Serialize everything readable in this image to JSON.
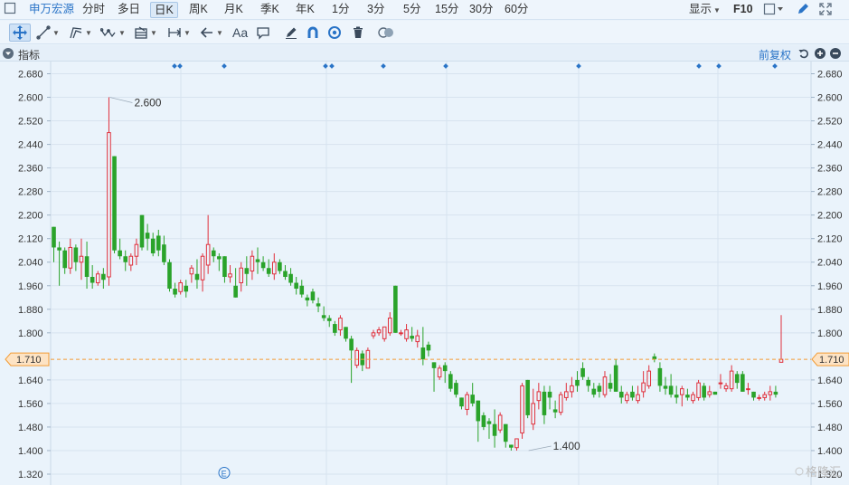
{
  "topbar": {
    "stock_name": "申万宏源",
    "periods": [
      "分时",
      "多日",
      "日K",
      "周K",
      "月K",
      "季K",
      "年K",
      "1分",
      "3分",
      "5分",
      "15分",
      "30分",
      "60分"
    ],
    "active_period": "日K",
    "display_label": "显示",
    "f10_label": "F10"
  },
  "toolbar": {
    "text_tool_label": "Aa"
  },
  "indicator_bar": {
    "label": "指标",
    "adjust_label": "前复权"
  },
  "icons": [
    "arrows-cross-icon",
    "line-tool-icon",
    "polyline-tool-icon",
    "wave-tool-icon",
    "fib-tool-icon",
    "measure-tool-icon",
    "arrow-left-icon",
    "text-tool-icon",
    "comment-icon",
    "pen-icon",
    "magnet-icon",
    "eye-icon",
    "trash-icon",
    "toggle-icon",
    "square-icon",
    "pencil-icon",
    "fullscreen-icon",
    "undo-icon",
    "zoom-in-icon",
    "zoom-out-icon",
    "chevron-down-icon"
  ],
  "colors": {
    "up": "#e0303c",
    "down": "#2aa32a",
    "accent": "#2a74c7",
    "current_line": "#f39b33"
  },
  "watermark": "格隆汇",
  "event_marker": "E",
  "chart_data": {
    "type": "candlestick",
    "y_ticks": [
      "2.680",
      "2.600",
      "2.520",
      "2.440",
      "2.360",
      "2.280",
      "2.200",
      "2.120",
      "2.040",
      "1.960",
      "1.880",
      "1.800",
      "1.640",
      "1.560",
      "1.480",
      "1.400",
      "1.320"
    ],
    "ylim": [
      1.32,
      2.68
    ],
    "current_price": "1.710",
    "annotations": [
      {
        "text": "2.600",
        "value": 2.6,
        "index": 10
      },
      {
        "text": "1.400",
        "value": 1.4,
        "index": 86
      }
    ],
    "candles": [
      [
        2.16,
        2.16,
        2.04,
        2.09
      ],
      [
        2.09,
        2.11,
        1.96,
        2.08
      ],
      [
        2.08,
        2.09,
        2.0,
        2.02
      ],
      [
        2.02,
        2.12,
        2.0,
        2.09
      ],
      [
        2.09,
        2.1,
        2.01,
        2.04
      ],
      [
        2.04,
        2.12,
        1.98,
        2.06
      ],
      [
        2.06,
        2.11,
        1.95,
        1.99
      ],
      [
        1.99,
        2.03,
        1.95,
        1.97
      ],
      [
        1.97,
        2.01,
        1.96,
        2.0
      ],
      [
        2.0,
        2.02,
        1.95,
        1.98
      ],
      [
        1.99,
        2.6,
        1.96,
        2.48
      ],
      [
        2.4,
        2.4,
        2.07,
        2.08
      ],
      [
        2.08,
        2.12,
        2.05,
        2.06
      ],
      [
        2.06,
        2.08,
        2.01,
        2.04
      ],
      [
        2.03,
        2.07,
        2.01,
        2.06
      ],
      [
        2.06,
        2.12,
        2.03,
        2.1
      ],
      [
        2.2,
        2.2,
        2.08,
        2.09
      ],
      [
        2.14,
        2.17,
        2.08,
        2.12
      ],
      [
        2.12,
        2.14,
        2.06,
        2.07
      ],
      [
        2.13,
        2.15,
        2.06,
        2.08
      ],
      [
        2.1,
        2.13,
        2.03,
        2.04
      ],
      [
        2.04,
        2.05,
        1.94,
        1.95
      ],
      [
        1.95,
        1.97,
        1.92,
        1.93
      ],
      [
        1.94,
        1.98,
        1.93,
        1.97
      ],
      [
        1.96,
        1.98,
        1.92,
        1.94
      ],
      [
        2.0,
        2.03,
        1.97,
        2.02
      ],
      [
        2.0,
        2.05,
        1.95,
        1.98
      ],
      [
        1.98,
        2.07,
        1.94,
        2.06
      ],
      [
        2.03,
        2.2,
        2.0,
        2.1
      ],
      [
        2.08,
        2.09,
        2.04,
        2.06
      ],
      [
        2.06,
        2.07,
        2.01,
        2.05
      ],
      [
        2.06,
        2.06,
        1.97,
        1.99
      ],
      [
        1.99,
        2.03,
        1.97,
        2.0
      ],
      [
        1.96,
        2.02,
        1.92,
        1.92
      ],
      [
        1.97,
        2.04,
        1.94,
        2.02
      ],
      [
        2.02,
        2.06,
        1.96,
        2.0
      ],
      [
        2.01,
        2.08,
        1.98,
        2.06
      ],
      [
        2.05,
        2.09,
        2.0,
        2.04
      ],
      [
        2.04,
        2.06,
        2.01,
        2.02
      ],
      [
        2.02,
        2.05,
        1.99,
        2.0
      ],
      [
        2.0,
        2.07,
        1.98,
        2.04
      ],
      [
        2.04,
        2.05,
        2.0,
        2.01
      ],
      [
        2.01,
        2.03,
        1.98,
        1.99
      ],
      [
        2.0,
        2.02,
        1.96,
        1.97
      ],
      [
        1.97,
        1.99,
        1.93,
        1.95
      ],
      [
        1.96,
        1.98,
        1.92,
        1.93
      ],
      [
        1.92,
        1.93,
        1.89,
        1.91
      ],
      [
        1.94,
        1.95,
        1.9,
        1.91
      ],
      [
        1.9,
        1.92,
        1.87,
        1.89
      ],
      [
        1.86,
        1.89,
        1.84,
        1.85
      ],
      [
        1.85,
        1.86,
        1.82,
        1.84
      ],
      [
        1.83,
        1.84,
        1.79,
        1.8
      ],
      [
        1.81,
        1.86,
        1.79,
        1.85
      ],
      [
        1.82,
        1.82,
        1.77,
        1.78
      ],
      [
        1.78,
        1.79,
        1.63,
        1.74
      ],
      [
        1.69,
        1.75,
        1.68,
        1.74
      ],
      [
        1.73,
        1.74,
        1.67,
        1.69
      ],
      [
        1.68,
        1.75,
        1.68,
        1.74
      ],
      [
        1.79,
        1.81,
        1.78,
        1.8
      ],
      [
        1.8,
        1.82,
        1.79,
        1.81
      ],
      [
        1.78,
        1.82,
        1.77,
        1.82
      ],
      [
        1.8,
        1.87,
        1.79,
        1.85
      ],
      [
        1.96,
        1.96,
        1.8,
        1.8
      ],
      [
        1.8,
        1.81,
        1.79,
        1.8
      ],
      [
        1.78,
        1.83,
        1.77,
        1.81
      ],
      [
        1.79,
        1.82,
        1.77,
        1.78
      ],
      [
        1.77,
        1.81,
        1.75,
        1.79
      ],
      [
        1.75,
        1.82,
        1.69,
        1.71
      ],
      [
        1.76,
        1.77,
        1.72,
        1.74
      ],
      [
        1.7,
        1.7,
        1.6,
        1.68
      ],
      [
        1.65,
        1.69,
        1.64,
        1.68
      ],
      [
        1.69,
        1.7,
        1.63,
        1.67
      ],
      [
        1.66,
        1.67,
        1.6,
        1.61
      ],
      [
        1.63,
        1.64,
        1.58,
        1.59
      ],
      [
        1.58,
        1.58,
        1.54,
        1.55
      ],
      [
        1.54,
        1.6,
        1.52,
        1.59
      ],
      [
        1.59,
        1.63,
        1.55,
        1.56
      ],
      [
        1.57,
        1.57,
        1.43,
        1.5
      ],
      [
        1.52,
        1.53,
        1.47,
        1.48
      ],
      [
        1.5,
        1.51,
        1.44,
        1.49
      ],
      [
        1.49,
        1.54,
        1.41,
        1.45
      ],
      [
        1.47,
        1.53,
        1.46,
        1.52
      ],
      [
        1.49,
        1.49,
        1.41,
        1.43
      ],
      [
        1.42,
        1.42,
        1.4,
        1.41
      ],
      [
        1.41,
        1.44,
        1.4,
        1.44
      ],
      [
        1.46,
        1.63,
        1.44,
        1.62
      ],
      [
        1.64,
        1.64,
        1.51,
        1.52
      ],
      [
        1.49,
        1.61,
        1.47,
        1.56
      ],
      [
        1.57,
        1.63,
        1.54,
        1.6
      ],
      [
        1.6,
        1.62,
        1.49,
        1.52
      ],
      [
        1.6,
        1.62,
        1.54,
        1.58
      ],
      [
        1.54,
        1.57,
        1.51,
        1.53
      ],
      [
        1.53,
        1.6,
        1.52,
        1.59
      ],
      [
        1.58,
        1.63,
        1.57,
        1.6
      ],
      [
        1.6,
        1.65,
        1.58,
        1.62
      ],
      [
        1.64,
        1.67,
        1.6,
        1.62
      ],
      [
        1.68,
        1.7,
        1.64,
        1.65
      ],
      [
        1.64,
        1.65,
        1.6,
        1.62
      ],
      [
        1.61,
        1.63,
        1.58,
        1.59
      ],
      [
        1.62,
        1.63,
        1.58,
        1.6
      ],
      [
        1.59,
        1.67,
        1.58,
        1.65
      ],
      [
        1.63,
        1.66,
        1.6,
        1.61
      ],
      [
        1.69,
        1.71,
        1.6,
        1.6
      ],
      [
        1.6,
        1.62,
        1.56,
        1.58
      ],
      [
        1.57,
        1.6,
        1.56,
        1.59
      ],
      [
        1.6,
        1.62,
        1.57,
        1.58
      ],
      [
        1.57,
        1.62,
        1.56,
        1.59
      ],
      [
        1.6,
        1.67,
        1.58,
        1.63
      ],
      [
        1.62,
        1.69,
        1.61,
        1.67
      ],
      [
        1.72,
        1.73,
        1.7,
        1.71
      ],
      [
        1.68,
        1.7,
        1.6,
        1.62
      ],
      [
        1.62,
        1.65,
        1.59,
        1.61
      ],
      [
        1.62,
        1.66,
        1.58,
        1.59
      ],
      [
        1.59,
        1.62,
        1.56,
        1.58
      ],
      [
        1.59,
        1.62,
        1.55,
        1.61
      ],
      [
        1.59,
        1.61,
        1.57,
        1.58
      ],
      [
        1.57,
        1.6,
        1.56,
        1.59
      ],
      [
        1.58,
        1.64,
        1.57,
        1.63
      ],
      [
        1.62,
        1.63,
        1.57,
        1.58
      ],
      [
        1.59,
        1.62,
        1.58,
        1.6
      ],
      [
        1.6,
        1.6,
        1.59,
        1.59
      ],
      [
        1.63,
        1.66,
        1.61,
        1.63
      ],
      [
        1.61,
        1.63,
        1.6,
        1.62
      ],
      [
        1.61,
        1.69,
        1.6,
        1.67
      ],
      [
        1.66,
        1.67,
        1.61,
        1.63
      ],
      [
        1.66,
        1.67,
        1.6,
        1.6
      ],
      [
        1.61,
        1.63,
        1.59,
        1.61
      ],
      [
        1.6,
        1.6,
        1.57,
        1.58
      ],
      [
        1.58,
        1.59,
        1.57,
        1.58
      ],
      [
        1.58,
        1.6,
        1.57,
        1.59
      ],
      [
        1.59,
        1.62,
        1.57,
        1.6
      ],
      [
        1.6,
        1.62,
        1.58,
        1.59
      ],
      [
        1.7,
        1.86,
        1.7,
        1.71
      ]
    ]
  }
}
